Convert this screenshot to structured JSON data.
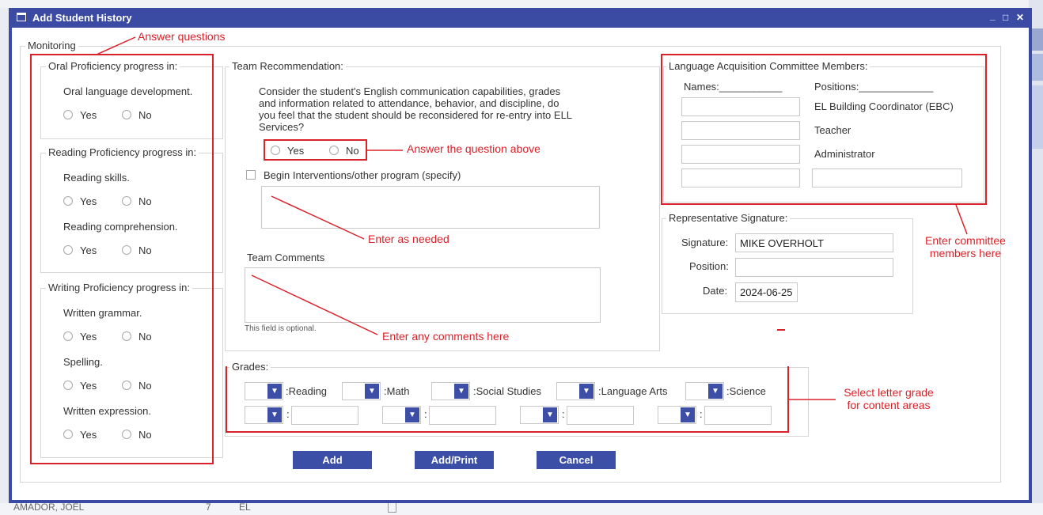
{
  "background": {
    "bottom_row": {
      "name": "AMADOR, JOEL",
      "count": "7",
      "program": "EL"
    }
  },
  "window": {
    "title": "Add Student History",
    "controls": {
      "minimize": "_",
      "maximize": "□",
      "close": "✕"
    }
  },
  "monitoring": {
    "legend": "Monitoring",
    "oral": {
      "legend": "Oral Proficiency progress in:",
      "items": [
        {
          "label": "Oral language development.",
          "yes": "Yes",
          "no": "No"
        }
      ]
    },
    "reading": {
      "legend": "Reading Proficiency progress in:",
      "items": [
        {
          "label": "Reading skills.",
          "yes": "Yes",
          "no": "No"
        },
        {
          "label": "Reading comprehension.",
          "yes": "Yes",
          "no": "No"
        }
      ]
    },
    "writing": {
      "legend": "Writing Proficiency progress in:",
      "items": [
        {
          "label": "Written grammar.",
          "yes": "Yes",
          "no": "No"
        },
        {
          "label": "Spelling.",
          "yes": "Yes",
          "no": "No"
        },
        {
          "label": "Written expression.",
          "yes": "Yes",
          "no": "No"
        }
      ]
    }
  },
  "team": {
    "legend": "Team Recommendation:",
    "question_lines": [
      "Consider the student's English communication capabilities, grades",
      "and information related to attendance, behavior, and discipline, do",
      "you feel that the student should be reconsidered for re-entry into ELL",
      "Services?"
    ],
    "yes": "Yes",
    "no": "No",
    "interventions_label": "Begin Interventions/other program (specify)",
    "comments_label": "Team Comments",
    "comments_hint": "This field is optional."
  },
  "committee": {
    "legend": "Language Acquisition Committee Members:",
    "names_header": "Names:___________",
    "positions_header": "Positions:_____________",
    "positions": [
      "EL Building Coordinator (EBC)",
      "Teacher",
      "Administrator"
    ]
  },
  "signature": {
    "legend": "Representative Signature:",
    "signature_label": "Signature:",
    "signature_value": "MIKE OVERHOLT",
    "position_label": "Position:",
    "date_label": "Date:",
    "date_value": "2024-06-25"
  },
  "grades": {
    "legend": "Grades:",
    "subjects": [
      ":Reading",
      ":Math",
      ":Social Studies",
      ":Language Arts",
      ":Science"
    ],
    "colon": ":"
  },
  "buttons": {
    "add": "Add",
    "add_print": "Add/Print",
    "cancel": "Cancel"
  },
  "annotations": {
    "answer_questions": "Answer questions",
    "answer_above": "Answer the question above",
    "enter_needed": "Enter as needed",
    "enter_comments": "Enter any comments here",
    "enter_committee_1": "Enter committee",
    "enter_committee_2": "members here",
    "select_grade_1": "Select letter grade",
    "select_grade_2": "for content areas"
  },
  "colors": {
    "accent": "#3b4aa2",
    "annotation": "#d9222a"
  }
}
